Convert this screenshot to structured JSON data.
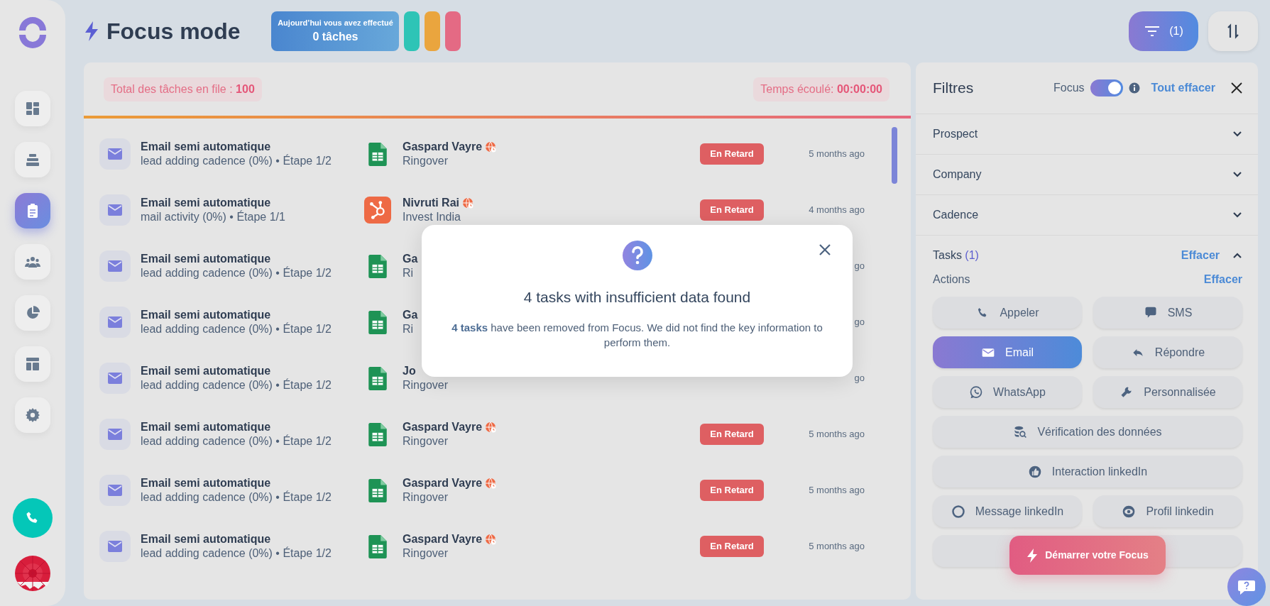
{
  "sidebar": {
    "nav": [
      {
        "selected": false
      },
      {
        "selected": false
      },
      {
        "selected": true
      },
      {
        "selected": false
      },
      {
        "selected": false
      },
      {
        "selected": false
      },
      {
        "selected": false
      }
    ]
  },
  "header": {
    "title": "Focus mode",
    "stats": {
      "label": "Aujourd’hui vous avez effectué",
      "value": "0 tâches"
    },
    "stat_pills": [
      {
        "color": "#2ec4b6"
      },
      {
        "color": "#eaa53e"
      },
      {
        "color": "#e46a84"
      }
    ],
    "filter_button": {
      "label": "(1)",
      "active": true
    }
  },
  "queue": {
    "total": "Total des tâches en file : **100**",
    "elapsed": "Temps écoulé: **00:00:00**"
  },
  "tasks": [
    {
      "title": "Email semi automatique",
      "subtitle": "lead adding cadence (0%) • Étape 1/2",
      "kind": "sheet",
      "contact": "Gaspard Vayre",
      "company": "Ringover",
      "status": "En Retard",
      "time": "5 months ago"
    },
    {
      "title": "Email semi automatique",
      "subtitle": "mail activity (0%) • Étape 1/1",
      "kind": "hubspot",
      "contact": "Nivruti Rai",
      "company": "Invest India",
      "status": "En Retard",
      "time": "4 months ago"
    },
    {
      "title": "Email semi automatique",
      "subtitle": "lead adding cadence (0%) • Étape 1/2",
      "kind": "sheet",
      "contact": "Ga",
      "company": "Ri",
      "time": "go"
    },
    {
      "title": "Email semi automatique",
      "subtitle": "lead adding cadence (0%) • Étape 1/2",
      "kind": "sheet",
      "contact": "Ga",
      "company": "Ri",
      "time": "go"
    },
    {
      "title": "Email semi automatique",
      "subtitle": "lead adding cadence (0%) • Étape 1/2",
      "kind": "sheet",
      "contact": "Jo",
      "company": "Ringover",
      "time": "go"
    },
    {
      "title": "Email semi automatique",
      "subtitle": "lead adding cadence (0%) • Étape 1/2",
      "kind": "sheet",
      "contact": "Gaspard Vayre",
      "company": "Ringover",
      "status": "En Retard",
      "time": "5 months ago"
    },
    {
      "title": "Email semi automatique",
      "subtitle": "lead adding cadence (0%) • Étape 1/2",
      "kind": "sheet",
      "contact": "Gaspard Vayre",
      "company": "Ringover",
      "status": "En Retard",
      "time": "5 months ago"
    },
    {
      "title": "Email semi automatique",
      "subtitle": "lead adding cadence (0%) • Étape 1/2",
      "kind": "sheet",
      "contact": "Gaspard Vayre",
      "company": "Ringover",
      "status": "En Retard",
      "time": "5 months ago"
    }
  ],
  "modal": {
    "title": "4 tasks with insufficient data found",
    "message": "**4 tasks** have been removed from Focus. We did not find the key information to perform them."
  },
  "filters": {
    "title": "Filtres",
    "focus_label": "Focus",
    "focus_on": true,
    "clear_all": "Tout effacer",
    "sections": [
      {
        "label": "Prospect",
        "expanded": false
      },
      {
        "label": "Company",
        "expanded": false
      },
      {
        "label": "Cadence",
        "expanded": false
      },
      {
        "label": "Tasks",
        "count": "(1)",
        "clear": "Effacer",
        "expanded": true
      }
    ],
    "actions_label": "Actions",
    "actions_clear": "Effacer",
    "actions": [
      {
        "label": "Appeler",
        "kind": "half",
        "selected": false
      },
      {
        "label": "SMS",
        "kind": "half",
        "selected": false
      },
      {
        "label": "Email",
        "kind": "half",
        "selected": true
      },
      {
        "label": "Répondre",
        "kind": "half",
        "selected": false
      },
      {
        "label": "WhatsApp",
        "kind": "half",
        "selected": false
      },
      {
        "label": "Personnalisée",
        "kind": "half",
        "selected": false
      },
      {
        "label": "Vérification des données",
        "kind": "full",
        "selected": false
      },
      {
        "label": "Interaction linkedIn",
        "kind": "full",
        "selected": false
      },
      {
        "label": "Message linkedIn",
        "kind": "half",
        "selected": false
      },
      {
        "label": "Profil linkedin",
        "kind": "half",
        "selected": false
      },
      {
        "kind": "full",
        "selected": false
      }
    ],
    "start_button": "Démarrer votre Focus"
  }
}
